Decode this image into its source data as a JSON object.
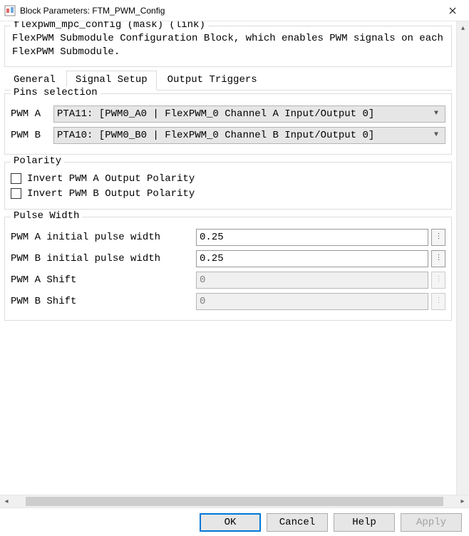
{
  "window": {
    "title": "Block Parameters: FTM_PWM_Config"
  },
  "desc": {
    "legend": "flexpwm_mpc_config (mask) (link)",
    "text": "FlexPWM Submodule Configuration Block, which enables PWM signals on each FlexPWM Submodule."
  },
  "tabs": {
    "general": "General",
    "signal_setup": "Signal Setup",
    "output_triggers": "Output Triggers",
    "active": "signal_setup"
  },
  "pins": {
    "legend": "Pins selection",
    "pwm_a_label": "PWM A",
    "pwm_a_value": "PTA11: [PWM0_A0 | FlexPWM_0 Channel A Input/Output 0]",
    "pwm_b_label": "PWM B",
    "pwm_b_value": "PTA10: [PWM0_B0 | FlexPWM_0 Channel B Input/Output 0]"
  },
  "polarity": {
    "legend": "Polarity",
    "invert_a": "Invert PWM A Output Polarity",
    "invert_b": "Invert PWM B Output Polarity"
  },
  "pulse": {
    "legend": "Pulse Width",
    "a_label": "PWM A initial pulse width",
    "a_value": "0.25",
    "b_label": "PWM B initial pulse width",
    "b_value": "0.25",
    "shift_a_label": "PWM A Shift",
    "shift_a_value": "0",
    "shift_b_label": "PWM B Shift",
    "shift_b_value": "0"
  },
  "buttons": {
    "ok": "OK",
    "cancel": "Cancel",
    "help": "Help",
    "apply": "Apply"
  }
}
